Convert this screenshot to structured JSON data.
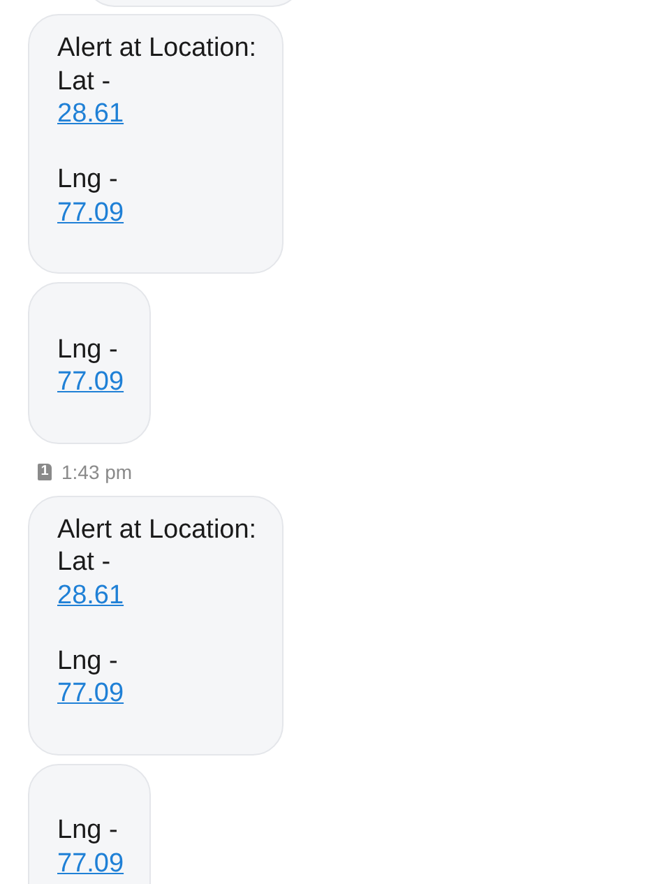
{
  "messages": [
    {
      "kind": "bubble_edge"
    },
    {
      "kind": "bubble",
      "lines": [
        {
          "kind": "text",
          "text": "Alert at Location:"
        },
        {
          "kind": "text",
          "text": "Lat -"
        },
        {
          "kind": "link",
          "text": "28.61"
        },
        {
          "kind": "blank"
        },
        {
          "kind": "text",
          "text": "Lng -"
        },
        {
          "kind": "link",
          "text": "77.09"
        }
      ]
    },
    {
      "kind": "bubble",
      "lines": [
        {
          "kind": "blank"
        },
        {
          "kind": "text",
          "text": "Lng -"
        },
        {
          "kind": "link",
          "text": "77.09"
        }
      ]
    },
    {
      "kind": "timestamp",
      "sim": "1",
      "time": "1:43 pm"
    },
    {
      "kind": "bubble",
      "lines": [
        {
          "kind": "text",
          "text": "Alert at Location:"
        },
        {
          "kind": "text",
          "text": "Lat -"
        },
        {
          "kind": "link",
          "text": "28.61"
        },
        {
          "kind": "blank"
        },
        {
          "kind": "text",
          "text": "Lng -"
        },
        {
          "kind": "link",
          "text": "77.09"
        }
      ]
    },
    {
      "kind": "bubble",
      "lines": [
        {
          "kind": "blank"
        },
        {
          "kind": "text",
          "text": "Lng -"
        },
        {
          "kind": "link",
          "text": "77.09"
        }
      ]
    }
  ]
}
